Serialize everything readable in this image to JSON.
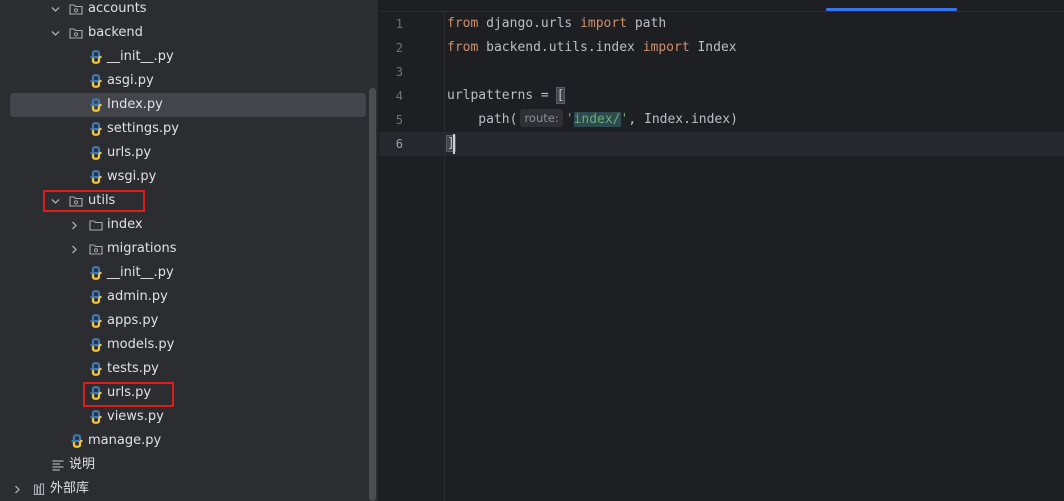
{
  "project_tree": {
    "rows": [
      {
        "label": "accounts",
        "icon": "package-folder-icon",
        "chevron": "down"
      },
      {
        "label": "backend",
        "icon": "package-folder-icon",
        "chevron": "down"
      },
      {
        "label": "__init__.py",
        "icon": "python-file-icon"
      },
      {
        "label": "asgi.py",
        "icon": "python-file-icon"
      },
      {
        "label": "Index.py",
        "icon": "python-file-icon",
        "selected": true
      },
      {
        "label": "settings.py",
        "icon": "python-file-icon"
      },
      {
        "label": "urls.py",
        "icon": "python-file-icon"
      },
      {
        "label": "wsgi.py",
        "icon": "python-file-icon"
      },
      {
        "label": "utils",
        "icon": "package-folder-icon",
        "chevron": "down",
        "highlighted": true
      },
      {
        "label": "index",
        "icon": "folder-icon",
        "chevron": "right"
      },
      {
        "label": "migrations",
        "icon": "package-folder-icon",
        "chevron": "right"
      },
      {
        "label": "__init__.py",
        "icon": "python-file-icon"
      },
      {
        "label": "admin.py",
        "icon": "python-file-icon"
      },
      {
        "label": "apps.py",
        "icon": "python-file-icon"
      },
      {
        "label": "models.py",
        "icon": "python-file-icon"
      },
      {
        "label": "tests.py",
        "icon": "python-file-icon"
      },
      {
        "label": "urls.py",
        "icon": "python-file-icon",
        "highlighted": true
      },
      {
        "label": "views.py",
        "icon": "python-file-icon"
      },
      {
        "label": "manage.py",
        "icon": "python-file-icon"
      },
      {
        "label": "说明",
        "icon": "text-lines-icon"
      },
      {
        "label": "外部库",
        "icon": "library-icon",
        "chevron": "right"
      }
    ]
  },
  "editor": {
    "line_numbers": [
      "1",
      "2",
      "3",
      "4",
      "5",
      "6"
    ],
    "current_line": "6",
    "code": {
      "l1_from": "from",
      "l1_module": " django.urls ",
      "l1_import": "import",
      "l1_name": " path",
      "l2_from": "from",
      "l2_module": " backend.utils.index ",
      "l2_import": "import",
      "l2_name": " Index",
      "l4_text": "urlpatterns = ",
      "l4_bracket": "[",
      "l5_indent": "    path(",
      "l5_hint": "route:",
      "l5_q1": "'",
      "l5_string": "index/",
      "l5_q2": "'",
      "l5_rest": ", Index.index)",
      "l6_bracket": "]"
    }
  },
  "colors": {
    "keyword": "#cf8e6d",
    "string": "#6aab73",
    "highlight_box": "#e01b1b",
    "active_tab": "#3574f0"
  }
}
